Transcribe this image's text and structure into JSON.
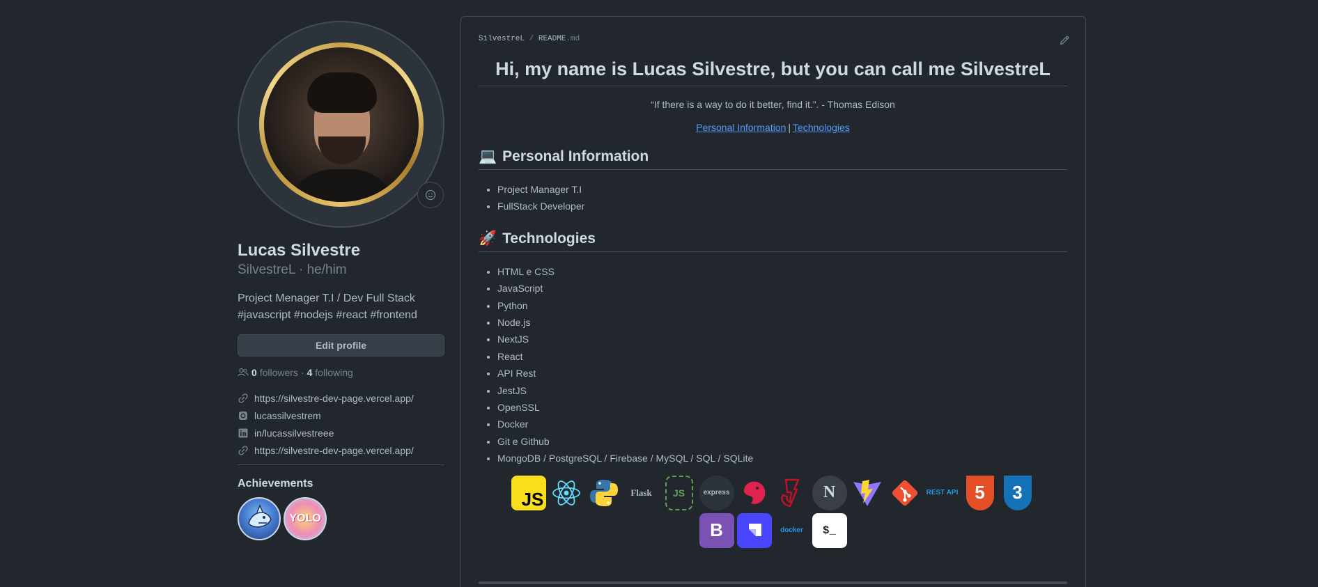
{
  "profile": {
    "full_name": "Lucas Silvestre",
    "username": "SilvestreL",
    "pronouns": "he/him",
    "bio_line1": "Project Menager T.I / Dev Full Stack",
    "bio_line2": "#javascript #nodejs #react #frontend",
    "edit_button": "Edit profile",
    "followers_count": "0",
    "followers_label": "followers",
    "following_count": "4",
    "following_label": "following",
    "links": [
      {
        "icon": "link-icon",
        "text": "https://silvestre-dev-page.vercel.app/"
      },
      {
        "icon": "instagram-icon",
        "text": "lucassilvestrem"
      },
      {
        "icon": "linkedin-icon",
        "text": "in/lucassilvestreee"
      },
      {
        "icon": "link-icon",
        "text": "https://silvestre-dev-page.vercel.app/"
      }
    ],
    "achievements_title": "Achievements",
    "badges": [
      {
        "name": "shark-badge"
      },
      {
        "name": "yolo-badge",
        "text": "YOLO"
      }
    ]
  },
  "readme": {
    "path_owner": "SilvestreL",
    "path_sep": "/",
    "path_file": "README",
    "path_ext": ".md",
    "title": "Hi, my name is Lucas Silvestre, but you can call me SilvestreL",
    "quote": "“If there is a way to do it better, find it.”. - Thomas Edison",
    "nav_personal": "Personal Information",
    "nav_separator": "|",
    "nav_tech": "Technologies",
    "section1_emoji": "💻",
    "section1_title": "Personal Information",
    "personal_items": [
      "Project Manager T.I",
      "FullStack Developer"
    ],
    "section2_emoji": "🚀",
    "section2_title": "Technologies",
    "tech_items": [
      "HTML e CSS",
      "JavaScript",
      "Python",
      "Node.js",
      "NextJS",
      "React",
      "API Rest",
      "JestJS",
      "OpenSSL",
      "Docker",
      "Git e Github",
      "MongoDB / PostgreSQL / Firebase / MySQL / SQL / SQLite"
    ],
    "tech_icons": [
      {
        "name": "javascript-icon",
        "label": "JS",
        "bg": "#f7df1e",
        "fg": "#000000"
      },
      {
        "name": "react-icon",
        "label": "",
        "bg": "transparent",
        "fg": "#61dafb"
      },
      {
        "name": "python-icon",
        "label": "",
        "bg": "transparent",
        "fg": "#3776ab"
      },
      {
        "name": "flask-icon",
        "label": "Flask",
        "bg": "transparent",
        "fg": "#adbac7"
      },
      {
        "name": "nodejs-icon",
        "label": "JS",
        "bg": "transparent",
        "fg": "#5fa04e"
      },
      {
        "name": "express-icon",
        "label": "express",
        "bg": "#2d333b",
        "fg": "#adbac7"
      },
      {
        "name": "nestjs-icon",
        "label": "",
        "bg": "transparent",
        "fg": "#e0234e"
      },
      {
        "name": "jest-icon",
        "label": "",
        "bg": "transparent",
        "fg": "#c21325"
      },
      {
        "name": "nextjs-icon",
        "label": "N",
        "bg": "#3a3f45",
        "fg": "#cdd9e5"
      },
      {
        "name": "vite-icon",
        "label": "",
        "bg": "transparent",
        "fg": "#ffd62e"
      },
      {
        "name": "git-icon",
        "label": "",
        "bg": "transparent",
        "fg": "#f05032"
      },
      {
        "name": "rest-api-icon",
        "label": "REST API",
        "bg": "transparent",
        "fg": "#1e9be0"
      },
      {
        "name": "html5-icon",
        "label": "5",
        "bg": "transparent",
        "fg": "#e34f26"
      },
      {
        "name": "css3-icon",
        "label": "3",
        "bg": "transparent",
        "fg": "#1572b6"
      },
      {
        "name": "bootstrap-icon",
        "label": "B",
        "bg": "#7952b3",
        "fg": "#ffffff"
      },
      {
        "name": "strapi-icon",
        "label": "",
        "bg": "#4945ff",
        "fg": "#ffffff"
      },
      {
        "name": "docker-icon",
        "label": "docker",
        "bg": "transparent",
        "fg": "#2496ed"
      },
      {
        "name": "bash-icon",
        "label": "$_",
        "bg": "#ffffff",
        "fg": "#22272e"
      }
    ]
  },
  "colors": {
    "background": "#22272e",
    "text": "#adbac7",
    "heading": "#cdd9e5",
    "muted": "#768390",
    "link": "#539bf5",
    "border": "#444c56"
  }
}
